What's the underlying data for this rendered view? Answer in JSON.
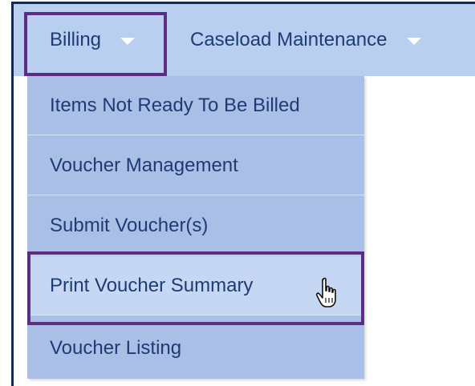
{
  "nav": {
    "billing_label": "Billing",
    "caseload_label": "Caseload Maintenance"
  },
  "dropdown": {
    "items": [
      {
        "label": "Items Not Ready To Be Billed"
      },
      {
        "label": "Voucher Management"
      },
      {
        "label": "Submit Voucher(s)"
      },
      {
        "label": "Print Voucher Summary"
      },
      {
        "label": "Voucher Listing"
      }
    ],
    "hovered_index": 3
  },
  "colors": {
    "navbar_bg": "#b8cff0",
    "menu_bg": "#a9bfe6",
    "menu_hover_bg": "#c6d7f3",
    "text": "#1f3b73",
    "highlight_border": "#5b2e82",
    "frame_border": "#16294f"
  },
  "icons": {
    "billing_caret": "chevron-down-icon",
    "caseload_caret": "chevron-down-icon",
    "cursor": "hand-pointer-icon"
  }
}
